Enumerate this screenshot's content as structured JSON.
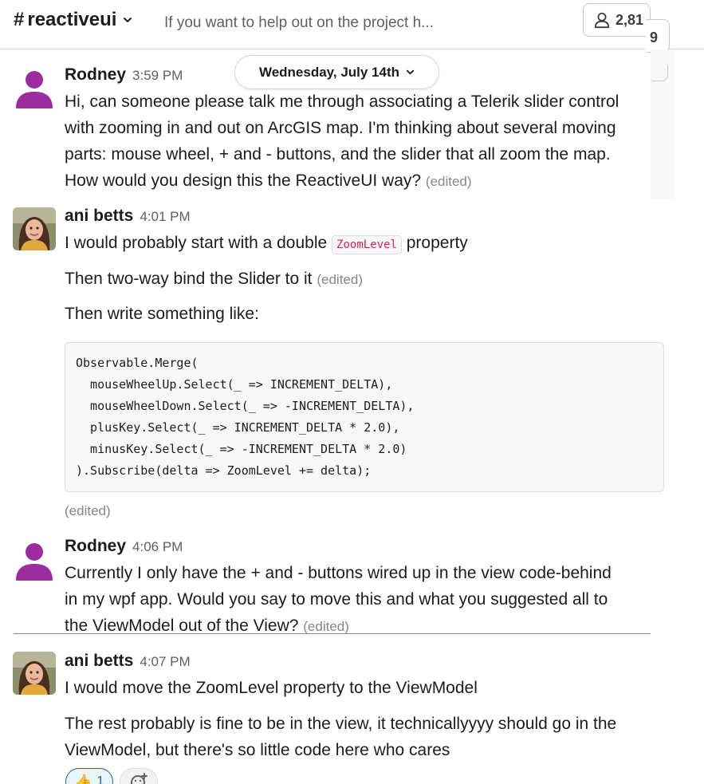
{
  "header": {
    "channel_hash": "#",
    "channel_name": "reactiveui",
    "topic": "If you want to help out on the project h...",
    "member_count": "2,81",
    "member_count_overflow": "9"
  },
  "date_divider": "Wednesday, July 14th",
  "messages": [
    {
      "author": "Rodney",
      "time": "3:59 PM",
      "lines": [
        "Hi, can someone please talk me through associating a Telerik slider control",
        "with zooming in and out on ArcGIS map. I'm thinking about several moving",
        "parts: mouse wheel, + and - buttons, and the slider that all zoom the map.",
        "How would you design this the ReactiveUI way?"
      ],
      "edited": "(edited)"
    },
    {
      "author": "ani betts",
      "time": "4:01 PM",
      "line1_before": "I would probably start with a double",
      "line1_code": "ZoomLevel",
      "line1_after": "property",
      "line2": "Then two-way bind the Slider to it",
      "line2_edited": "(edited)",
      "line3": "Then write something like:",
      "code": [
        "Observable.Merge(",
        "  mouseWheelUp.Select(_ => INCREMENT_DELTA),",
        "  mouseWheelDown.Select(_ => -INCREMENT_DELTA),",
        "  plusKey.Select(_ => INCREMENT_DELTA * 2.0),",
        "  minusKey.Select(_ => -INCREMENT_DELTA * 2.0)",
        ").Subscribe(delta => ZoomLevel += delta);"
      ],
      "edited": "(edited)"
    },
    {
      "author": "Rodney",
      "time": "4:06 PM",
      "lines": [
        "Currently I only have the + and - buttons wired up in the view code-behind",
        "in my wpf app. Would you say to move this and what you suggested all to",
        "the ViewModel out of the View?"
      ],
      "edited": "(edited)"
    },
    {
      "author": "ani betts",
      "time": "4:07 PM",
      "line1": "I would move the ZoomLevel property to the ViewModel",
      "line2": "The rest probably is fine to be in the view, it technicallyyyy should go in the",
      "line3": "ViewModel, but there's so little code here who cares",
      "reaction_emoji": "👍",
      "reaction_count": "1"
    }
  ],
  "colors": {
    "rodney_avatar": "#9b2d9e",
    "inline_code": "#e01e5a",
    "reaction_border": "#1264a3"
  },
  "icons": [
    "chevron-down-icon",
    "person-icon",
    "add-emoji-icon",
    "thumbs-up-emoji"
  ]
}
